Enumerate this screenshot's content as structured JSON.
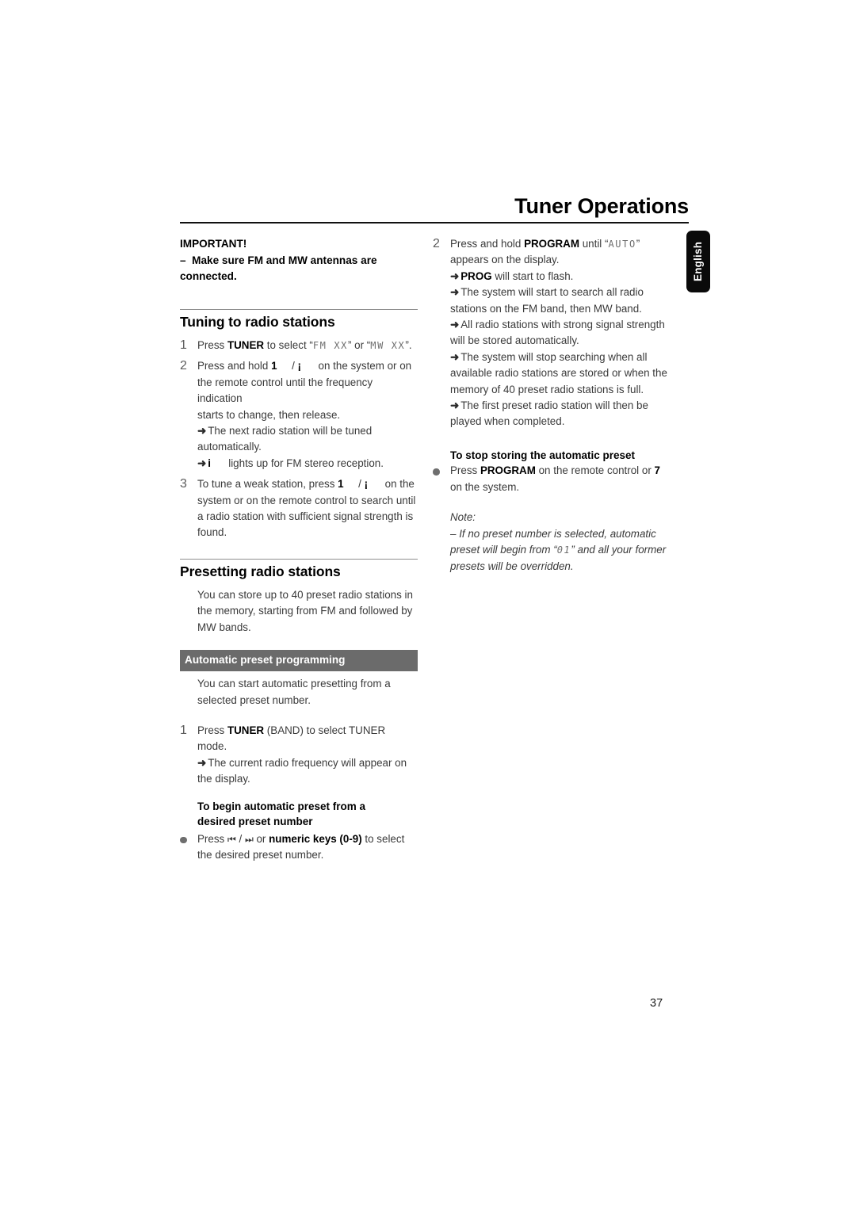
{
  "header": {
    "title": "Tuner Operations",
    "language_tab": "English"
  },
  "footer": {
    "page_number": "37"
  },
  "left_column": {
    "important": {
      "title": "IMPORTANT!",
      "dash": "–",
      "line1": "Make sure FM and MW antennas are",
      "line2": "connected."
    },
    "tuning_section": {
      "heading": "Tuning to radio stations",
      "steps": [
        {
          "num": "1",
          "text_before": "Press ",
          "bold": "TUNER",
          "text_after": " to select “",
          "lcd1": "FM  XX",
          "mid": "” or “",
          "lcd2": "MW  XX",
          "tail": "”."
        },
        {
          "num": "2",
          "line_a_before": "Press and hold ",
          "glyph_left": "1",
          "slash": "/",
          "glyph_right": "¡",
          "line_a_after": "on the system or on",
          "line_b": "the remote control until the frequency indication",
          "line_c": "starts to change, then release.",
          "results": [
            "The next radio station will be tuned automatically.",
            "lights up for FM stereo reception."
          ],
          "stereo_glyph": "i"
        },
        {
          "num": "3",
          "line_a_before": "To tune a weak station, press ",
          "glyph_left": "1",
          "slash": "/",
          "glyph_right": "¡",
          "line_a_after": "on the",
          "line_b": "system or on the remote control to search until",
          "line_c": "a radio station with sufficient signal strength is",
          "line_d": "found."
        }
      ]
    },
    "presetting_section": {
      "heading": "Presetting radio stations",
      "intro": "You can store up to 40 preset radio stations in the memory, starting from FM and followed by MW bands.",
      "band_label": "Automatic preset programming",
      "band_intro": "You can start automatic presetting from a selected preset number.",
      "step1": {
        "num": "1",
        "text_before": "Press ",
        "bold": "TUNER",
        "text_after": " (BAND) to select TUNER mode.",
        "result": "The current radio frequency will appear on the display."
      },
      "begin_subhead_line1": "To begin automatic preset from a",
      "begin_subhead_line2": "desired preset number",
      "begin_bullet": {
        "text_before": "Press ",
        "icon_prev": "⏮",
        "slash": " / ",
        "icon_next": "⏭",
        "text_mid": " or ",
        "bold": "numeric keys (0-9)",
        "text_after": " to select the desired preset number."
      }
    }
  },
  "right_column": {
    "step2": {
      "num": "2",
      "text_before": "Press and hold ",
      "bold": "PROGRAM",
      "text_mid": " until “",
      "lcd": "AUTO",
      "text_after": "” appears on the display.",
      "results": [
        {
          "bold": "PROG",
          "rest": " will start to flash."
        },
        {
          "bold": "",
          "rest": "The system will start to search all radio stations on the FM band, then MW band."
        },
        {
          "bold": "",
          "rest": "All radio stations with strong signal strength will be stored automatically."
        },
        {
          "bold": "",
          "rest": "The system will stop searching when all available radio stations are stored or when the memory of 40 preset radio stations is full."
        },
        {
          "bold": "",
          "rest": "The first preset radio station will then be played when completed."
        }
      ]
    },
    "stop_storing": {
      "subhead": "To stop storing the automatic preset",
      "bullet": {
        "text_before": "Press ",
        "bold": "PROGRAM",
        "text_mid": " on the remote control or ",
        "glyph": "7",
        "text_after": " on the system."
      }
    },
    "note": {
      "label": "Note:",
      "dash": "–",
      "part1": "If no preset number is selected,  automatic preset will begin from “",
      "lcd": "01",
      "part2": "” and all your former presets will be overridden."
    }
  },
  "icons": {
    "arrow": "➜",
    "bullet": "filled-circle"
  },
  "colors": {
    "band_gray": "#6b6b6b",
    "rule_gray": "#8e8e8e",
    "text": "#3a3a3a",
    "tab_black": "#0a0a0a"
  }
}
